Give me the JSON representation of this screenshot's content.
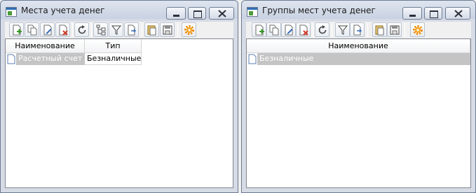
{
  "windows": [
    {
      "title": "Места учета денег",
      "columns": [
        "Наименование",
        "Тип"
      ],
      "rows": [
        {
          "name": "Расчетный счет",
          "type": "Безналичные"
        }
      ]
    },
    {
      "title": "Группы мест учета денег",
      "columns": [
        "Наименование"
      ],
      "rows": [
        {
          "name": "Безналичные"
        }
      ]
    }
  ],
  "toolbar_icons_a": [
    "add-icon",
    "copy-icon",
    "edit-icon",
    "delete-icon",
    "refresh-icon",
    "hierarchy-icon",
    "filter-icon",
    "filter-apply-icon",
    "paste-icon",
    "save-icon",
    "settings-gear-icon"
  ],
  "toolbar_icons_b": [
    "add-icon",
    "copy-icon",
    "edit-icon",
    "delete-icon",
    "refresh-icon",
    "filter-icon",
    "filter-apply-icon",
    "paste-icon",
    "save-icon",
    "settings-gear-icon"
  ],
  "colors": {
    "titlebar": "#c8d2e2",
    "selection": "#c4c4c4",
    "add_accent": "#3a9a2a",
    "delete_accent": "#d23a2a",
    "gear": "#f08a00"
  }
}
